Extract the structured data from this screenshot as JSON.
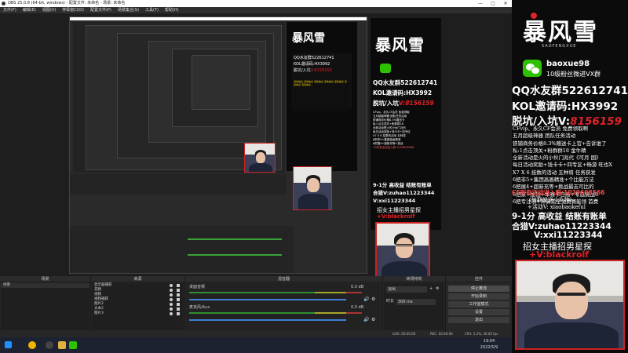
{
  "window": {
    "title": "OBS 25.0.8 (64-bit, windows) - 配置文件: 未命名 - 场景: 未命名",
    "minimize": "—",
    "maximize": "▢",
    "close": "✕"
  },
  "menu": [
    "文件(F)",
    "编辑(E)",
    "视图(V)",
    "停靠窗口(D)",
    "配置文件(P)",
    "场景集合(S)",
    "工具(T)",
    "帮助(H)"
  ],
  "overlay": {
    "logo": "暴风雪",
    "logo_sub": "SAOFENGXUE",
    "wechat_id": "baoxue98",
    "wechat_group": "10级粉丝微进VX群",
    "qq_group": "QQ水友群522612741",
    "kol_code": "KOL邀请码:HX3992",
    "pit_label": "脱坑/入坑V:",
    "pit_number": "8156159",
    "info_lines": [
      "CFvip、永久CF会员 免费领取啊",
      "五月超级神器 团队任务活动",
      "铁铺商务价格8.3%赠送卡上官+告诉谁了",
      "私:1点击顶关+粉群群18 金牛精",
      "全新活动是火的小伙门兆代《可月 固》",
      "每日活动奖励+钱卡卡+四专区+畅游 旺也X",
      "X7 X 6 挂数的活动 五种将 任务获发",
      "6把非5+集团高画精准+个比能方法",
      "6把展4+超新充等+挑战最志可比的",
      "6把家+加钱+本赛卡日高+专选挑战6",
      "6把专注项+神骑完全免费赛能领 首费"
    ],
    "cf_qq": "CF所有活动进入群:1029608566",
    "cf_note": "(加群就送小礼物)",
    "activity": "+活动V: xiaobaokeful",
    "earn_line": "9-1分 高收益 结账有账单",
    "partner": "合猎V:zuhao11223344",
    "vx_line": "V:xxi11223344",
    "recruit": "招女主播招男星探",
    "recruit_v": "+V:blackrolf",
    "colors": {
      "accent_red": "#e0222a",
      "text_white": "#ffffff",
      "bg_black": "#0b0b0b",
      "wechat_green": "#2dc100"
    }
  },
  "docks": {
    "scenes": {
      "title": "场景",
      "items": [
        "场景"
      ]
    },
    "sources": {
      "title": "来源",
      "items": [
        "显示器捕获",
        "音频",
        "视频",
        "视频捕获",
        "图片2",
        "文本2",
        "图片3"
      ]
    },
    "mixer": {
      "title": "混音器",
      "tracks": [
        {
          "name": "桌面音频",
          "db": "0.0 dB"
        },
        {
          "name": "麦克风/Aux",
          "db": "0.0 dB"
        }
      ]
    },
    "transitions": {
      "title": "转场特效",
      "fade": "淡出",
      "duration_label": "时长",
      "duration": "300 ms"
    },
    "controls": {
      "title": "控件",
      "buttons": [
        "停止推流",
        "开始录制",
        "工作室模式",
        "设置",
        "退出"
      ]
    }
  },
  "status": {
    "live": "LIVE: 00:00:00",
    "rec": "REC: 00:00:00",
    "cpu": "CPU: 5.2%, 30.00 fps"
  },
  "taskbar": {
    "time": "19:04",
    "date": "2022/5/9",
    "icons": [
      "windows-icon",
      "chrome-icon",
      "obs-icon",
      "folder-icon",
      "wechat-icon"
    ]
  }
}
